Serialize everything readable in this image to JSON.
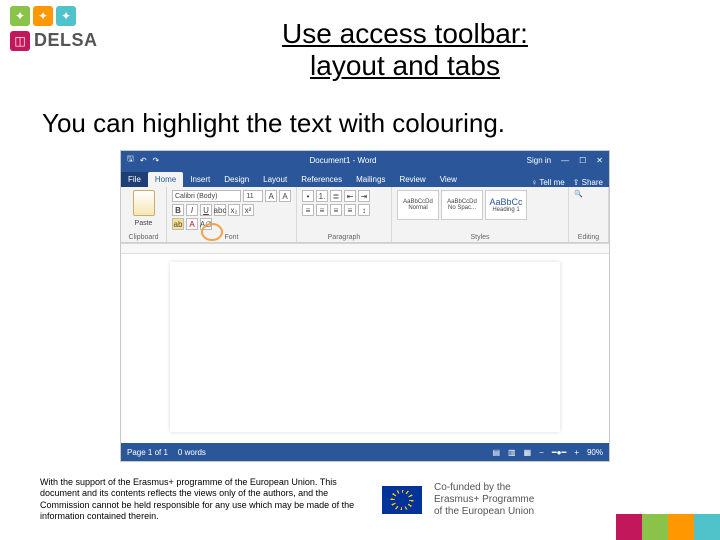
{
  "header": {
    "brand_name": "DELSA",
    "top_icons": [
      "puzzle",
      "bulb",
      "shield"
    ]
  },
  "slide": {
    "title_line1": "Use access toolbar:",
    "title_line2": "layout and tabs",
    "body_text": "You can highlight the text with colouring."
  },
  "word_app": {
    "titlebar": {
      "doc_title": "Document1 - Word",
      "signin": "Sign in",
      "qat": [
        "save",
        "undo",
        "redo"
      ]
    },
    "tabs": {
      "file": "File",
      "items": [
        "Home",
        "Insert",
        "Design",
        "Layout",
        "References",
        "Mailings",
        "Review",
        "View"
      ],
      "active_index": 0,
      "tellme": "Tell me",
      "share": "Share"
    },
    "ribbon": {
      "clipboard_label": "Clipboard",
      "paste_label": "Paste",
      "font_label": "Font",
      "font_name": "Calibri (Body)",
      "font_size": "11",
      "paragraph_label": "Paragraph",
      "styles_label": "Styles",
      "styles": [
        {
          "preview": "AaBbCcDd",
          "name": "Normal"
        },
        {
          "preview": "AaBbCcDd",
          "name": "No Spac..."
        },
        {
          "preview": "AaBbCc",
          "name": "Heading 1"
        }
      ],
      "editing_label": "Editing"
    },
    "statusbar": {
      "page": "Page 1 of 1",
      "words": "0 words",
      "zoom": "90%"
    }
  },
  "footer": {
    "disclaimer": "With the support of the Erasmus+ programme of the European Union. This document and its contents reflects the views only of the authors, and the Commission cannot be held responsible for any use which may be made of the information contained therein.",
    "cofunded_line1": "Co-funded by the",
    "cofunded_line2": "Erasmus+ Programme",
    "cofunded_line3": "of the European Union"
  },
  "colors": {
    "corner": [
      "#c2185b",
      "#8bc34a",
      "#ff9800",
      "#4fc3c9"
    ]
  }
}
